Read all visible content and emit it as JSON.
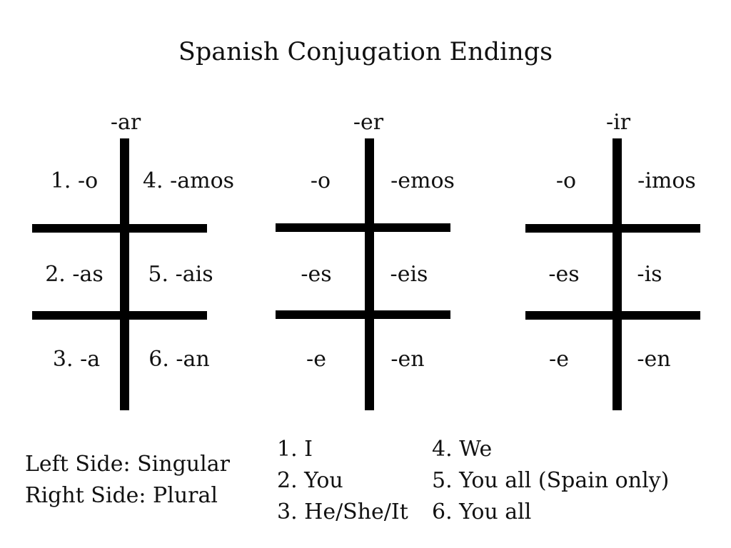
{
  "title": "Spanish Conjugation Endings",
  "tables": [
    {
      "header": "-ar",
      "rows": [
        [
          "1. -o",
          "4. -amos"
        ],
        [
          "2. -as",
          "5. -ais"
        ],
        [
          "3. -a",
          "6. -an"
        ]
      ]
    },
    {
      "header": "-er",
      "rows": [
        [
          "-o",
          "-emos"
        ],
        [
          "-es",
          "-eis"
        ],
        [
          "-e",
          "-en"
        ]
      ]
    },
    {
      "header": "-ir",
      "rows": [
        [
          "-o",
          "-imos"
        ],
        [
          "-es",
          "-is"
        ],
        [
          "-e",
          "-en"
        ]
      ]
    }
  ],
  "side_notes": [
    "Left Side: Singular",
    "Right Side: Plural"
  ],
  "persons_left": [
    "1. I",
    "2. You",
    "3. He/She/It"
  ],
  "persons_right": [
    "4. We",
    "5. You all (Spain only)",
    "6. You all"
  ]
}
